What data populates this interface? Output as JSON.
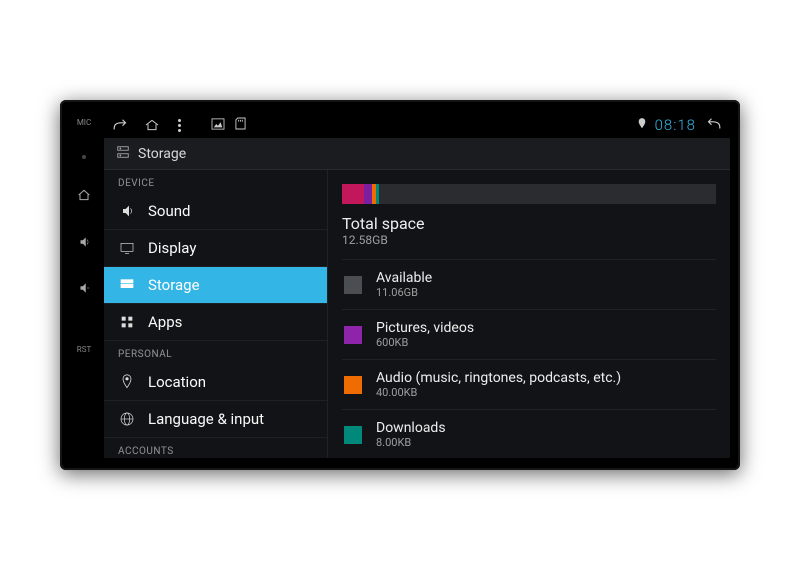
{
  "hardware": {
    "mic": "MIC",
    "rst": "RST"
  },
  "statusbar": {
    "time": "08:18"
  },
  "header": {
    "title": "Storage"
  },
  "sidebar": {
    "sections": {
      "device": {
        "label": "DEVICE"
      },
      "personal": {
        "label": "PERSONAL"
      },
      "accounts": {
        "label": "ACCOUNTS"
      }
    },
    "items": {
      "sound": {
        "label": "Sound"
      },
      "display": {
        "label": "Display"
      },
      "storage": {
        "label": "Storage"
      },
      "apps": {
        "label": "Apps"
      },
      "location": {
        "label": "Location"
      },
      "language": {
        "label": "Language & input"
      }
    }
  },
  "detail": {
    "total": {
      "label": "Total space",
      "value": "12.58GB"
    },
    "rows": {
      "available": {
        "label": "Available",
        "value": "11.06GB"
      },
      "pictures": {
        "label": "Pictures, videos",
        "value": "600KB"
      },
      "audio": {
        "label": "Audio (music, ringtones, podcasts, etc.)",
        "value": "40.00KB"
      },
      "downloads": {
        "label": "Downloads",
        "value": "8.00KB"
      }
    }
  }
}
